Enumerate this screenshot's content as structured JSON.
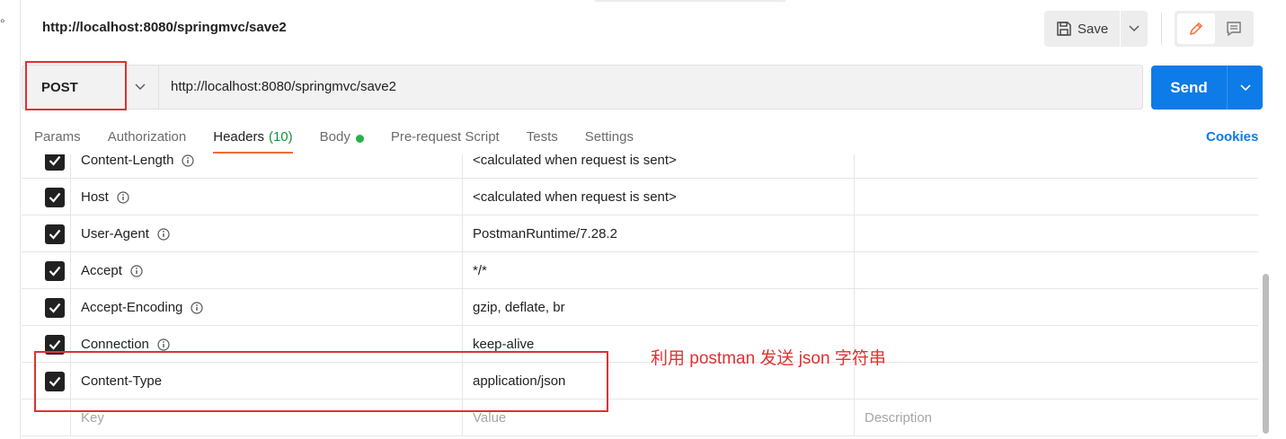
{
  "request": {
    "title": "http://localhost:8080/springmvc/save2",
    "method": "POST",
    "url": "http://localhost:8080/springmvc/save2"
  },
  "toolbar": {
    "save_label": "Save",
    "send_label": "Send"
  },
  "tabs": [
    {
      "label": "Params"
    },
    {
      "label": "Authorization"
    },
    {
      "label": "Headers",
      "count": "(10)"
    },
    {
      "label": "Body"
    },
    {
      "label": "Pre-request Script"
    },
    {
      "label": "Tests"
    },
    {
      "label": "Settings"
    }
  ],
  "cookies_label": "Cookies",
  "headers": [
    {
      "key": "Content-Length",
      "value": "<calculated when request is sent>",
      "checked": true
    },
    {
      "key": "Host",
      "value": "<calculated when request is sent>",
      "checked": true
    },
    {
      "key": "User-Agent",
      "value": "PostmanRuntime/7.28.2",
      "checked": true
    },
    {
      "key": "Accept",
      "value": "*/*",
      "checked": true
    },
    {
      "key": "Accept-Encoding",
      "value": "gzip, deflate, br",
      "checked": true
    },
    {
      "key": "Connection",
      "value": "keep-alive",
      "checked": true
    },
    {
      "key": "Content-Type",
      "value": "application/json",
      "checked": true
    }
  ],
  "new_row": {
    "key_placeholder": "Key",
    "value_placeholder": "Value",
    "description_placeholder": "Description"
  },
  "annotation": "利用 postman 发送 json 字符串",
  "colors": {
    "accent": "#0d7be8",
    "tab_underline": "#f26b3a",
    "highlight": "#e03131",
    "body_dot": "#26b24a"
  }
}
